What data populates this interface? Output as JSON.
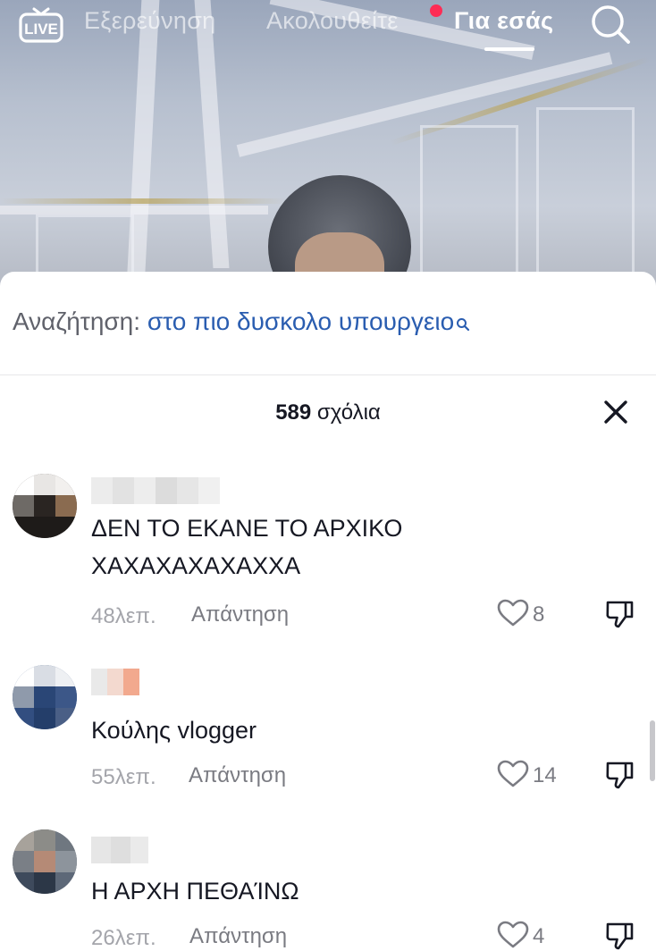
{
  "top_nav": {
    "live_label": "LIVE",
    "tabs": [
      {
        "label": "Εξερεύνηση"
      },
      {
        "label": "Ακολουθείτε"
      },
      {
        "label": "Για εσάς"
      }
    ],
    "notification_dot_color": "#fe2c55"
  },
  "search_suggestion": {
    "prefix": "Αναζήτηση:",
    "term": "στο πιο δυσκολο υπουργειο"
  },
  "comments_panel": {
    "count": "589",
    "count_label": "σχόλια",
    "comments": [
      {
        "text": "ΔΕΝ ΤΟ ΕΚΑΝΕ ΤΟ ΑΡΧΙΚΟ ΧΑΧΑΧΑΧΑΧΑΧΧΑ",
        "text_line1": "ΔΕΝ ΤΟ ΕΚΑΝΕ ΤΟ ΑΡΧΙΚΟ",
        "text_line2": "ΧΑΧΑΧΑΧΑΧΑΧΧΑ",
        "time": "48λεπ.",
        "reply_label": "Απάντηση",
        "likes": "8"
      },
      {
        "text": "Κούλης vlogger",
        "time": "55λεπ.",
        "reply_label": "Απάντηση",
        "likes": "14"
      },
      {
        "text": "Η ΑΡΧΗ ΠΕΘΑΊΝΩ",
        "time": "26λεπ.",
        "reply_label": "Απάντηση",
        "likes": "4"
      }
    ]
  },
  "icons": {
    "live": "live-tv-icon",
    "search": "search-icon",
    "close": "close-icon",
    "like": "heart-icon",
    "dislike": "thumbs-down-icon"
  },
  "colors": {
    "link_blue": "#2a5db0",
    "live_dot": "#fe2c55",
    "muted_text": "#a4a5ab"
  }
}
